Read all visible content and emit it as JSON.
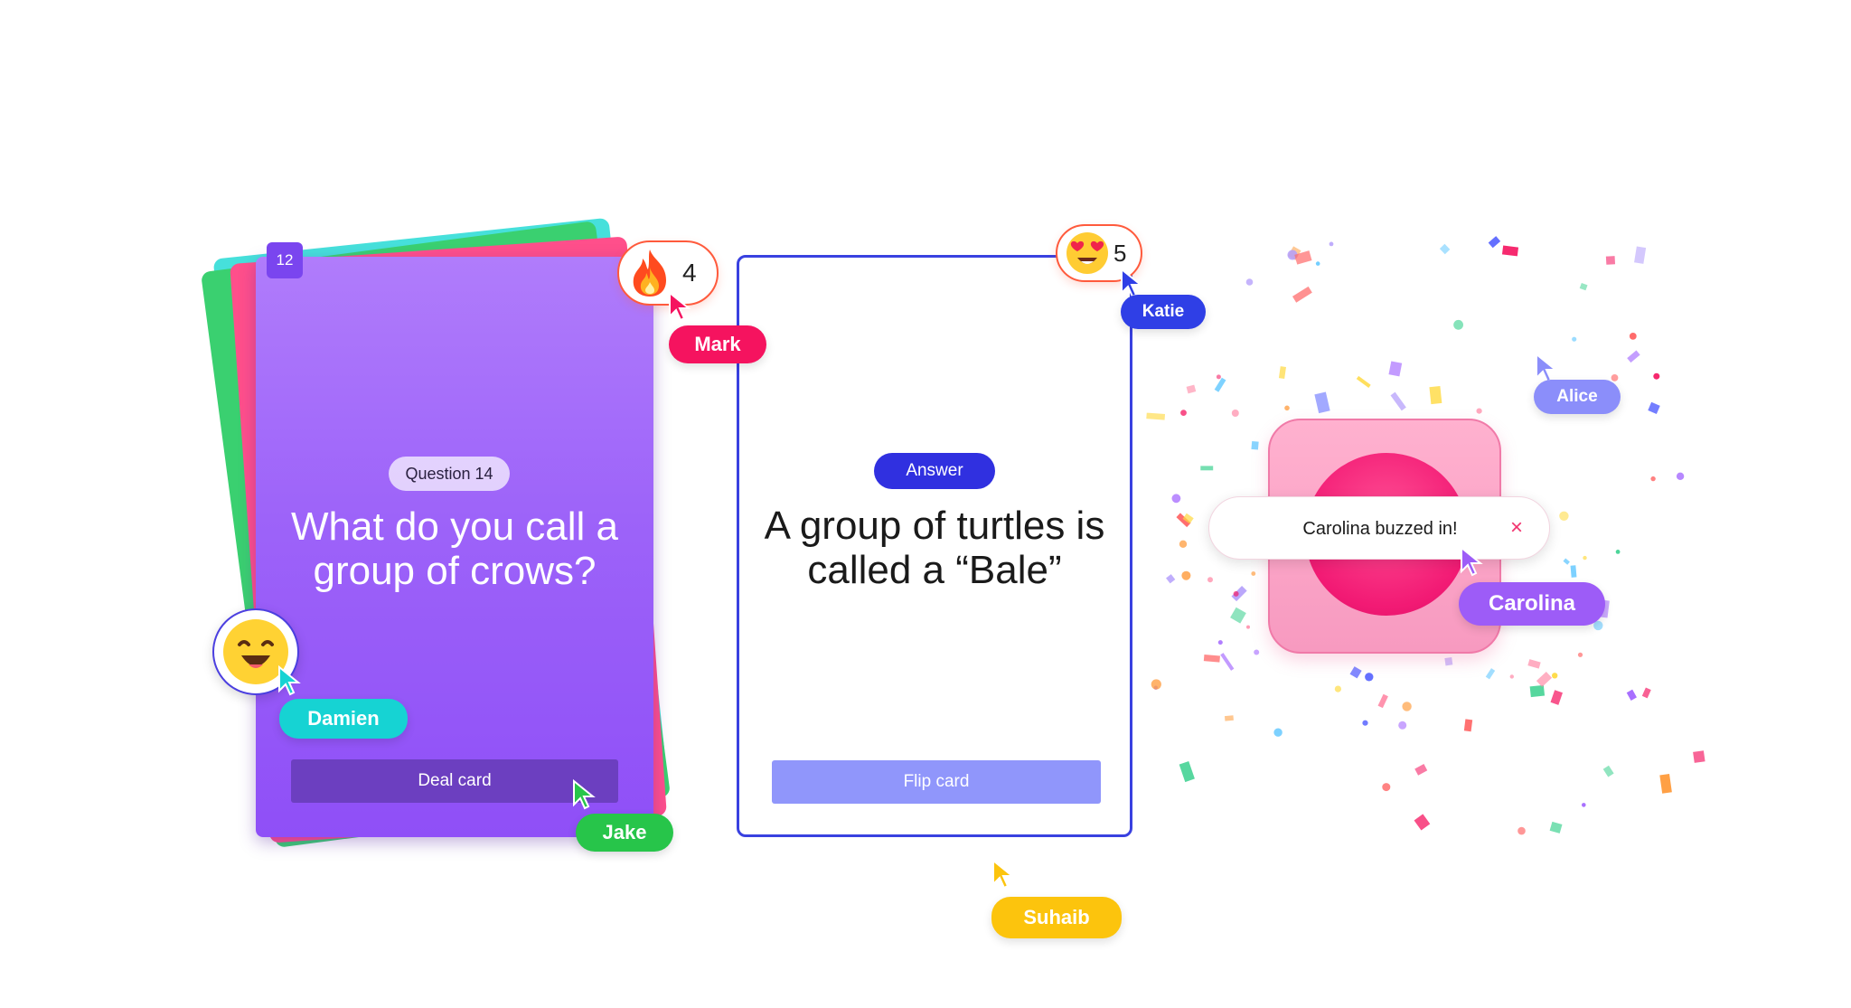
{
  "question_card": {
    "count_badge": "12",
    "label": "Question 14",
    "question": "What do you call a group of crows?",
    "deal_button": "Deal card"
  },
  "answer_card": {
    "label": "Answer",
    "answer": "A group of turtles is called a “Bale”",
    "flip_button": "Flip card"
  },
  "reactions": [
    {
      "icon": "fire-emoji-icon",
      "count": "4"
    },
    {
      "icon": "heart-eyes-emoji-icon",
      "count": "5"
    }
  ],
  "buzzer": {
    "toast_text": "Carolina buzzed in!",
    "close_glyph": "×"
  },
  "players": {
    "mark": {
      "name": "Mark",
      "color": "#f5135f"
    },
    "katie": {
      "name": "Katie",
      "color": "#2f3fe6"
    },
    "alice": {
      "name": "Alice",
      "color": "#8b8efa"
    },
    "carolina": {
      "name": "Carolina",
      "color": "#9d5cf7"
    },
    "damien": {
      "name": "Damien",
      "color": "#16d3d3"
    },
    "jake": {
      "name": "Jake",
      "color": "#27c54a"
    },
    "suhaib": {
      "name": "Suhaib",
      "color": "#fcc40d"
    }
  },
  "colors": {
    "question_card": "#9d63f9",
    "deal_button": "#6c3fc0",
    "answer_border": "#3941e0",
    "answer_pill": "#3030e0",
    "flip_button": "#9096fb",
    "buzzer": "#f21a74"
  }
}
